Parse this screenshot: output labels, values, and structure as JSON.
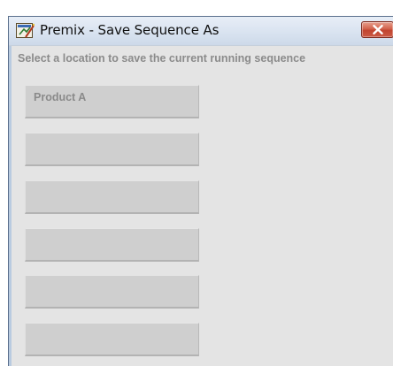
{
  "window": {
    "title": "Premix - Save Sequence As",
    "app_icon": "premix-app-icon",
    "close_icon": "close-icon"
  },
  "instruction": "Select a location to save the current running sequence",
  "slots": [
    {
      "label": "Product A"
    },
    {
      "label": ""
    },
    {
      "label": ""
    },
    {
      "label": ""
    },
    {
      "label": ""
    },
    {
      "label": ""
    }
  ],
  "colors": {
    "titlebar": "#d9e3f0",
    "body": "#e4e4e4",
    "slot": "#cfcfcf",
    "close": "#c14530",
    "text_muted": "#8b8b8b"
  }
}
